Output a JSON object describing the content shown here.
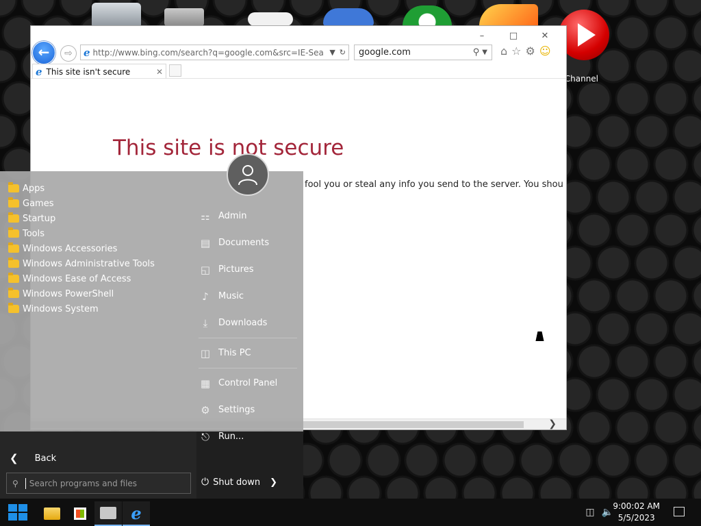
{
  "desktop": {
    "icons": [
      {
        "name": "recycle-bin-icon"
      },
      {
        "name": "folder-icon"
      },
      {
        "name": "game-controller-icon"
      },
      {
        "name": "settings-tool-icon"
      },
      {
        "name": "xbox-icon"
      },
      {
        "name": "firefox-icon"
      },
      {
        "name": "play-icon"
      }
    ],
    "channel_label": "r Channel"
  },
  "browser": {
    "address": "http://www.bing.com/search?q=google.com&src=IE-Sea",
    "search_value": "google.com",
    "tab_title": "This site isn't secure",
    "page": {
      "title": "This site is not secure",
      "visible_line": "fool you or steal any info you send to the server. You shou"
    }
  },
  "start_menu": {
    "apps": [
      "Apps",
      "Games",
      "Startup",
      "Tools",
      "Windows Accessories",
      "Windows Administrative Tools",
      "Windows Ease of Access",
      "Windows PowerShell",
      "Windows System"
    ],
    "places": [
      {
        "label": "Admin",
        "icon": "user-icon"
      },
      {
        "label": "Documents",
        "icon": "document-icon"
      },
      {
        "label": "Pictures",
        "icon": "picture-icon"
      },
      {
        "label": "Music",
        "icon": "music-icon"
      },
      {
        "label": "Downloads",
        "icon": "download-icon"
      },
      {
        "label": "This PC",
        "icon": "computer-icon"
      },
      {
        "label": "Control Panel",
        "icon": "control-panel-icon"
      },
      {
        "label": "Settings",
        "icon": "gear-icon"
      },
      {
        "label": "Run...",
        "icon": "run-icon"
      }
    ],
    "back_label": "Back",
    "search_placeholder": "Search programs and files",
    "shutdown_label": "Shut down"
  },
  "taskbar": {
    "time": "9:00:02 AM",
    "date": "5/5/2023",
    "accent": "#1e8fe8"
  }
}
